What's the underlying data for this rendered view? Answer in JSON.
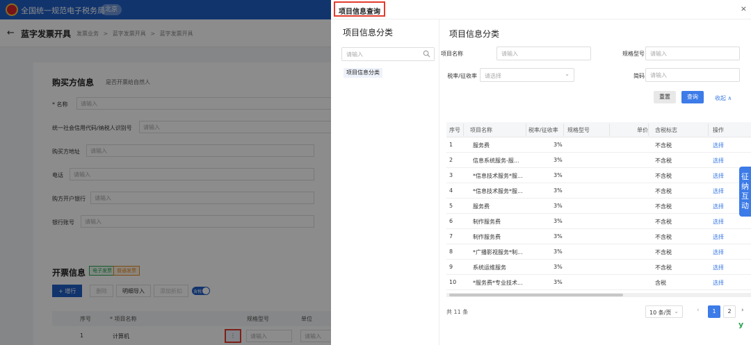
{
  "background": {
    "topbar": {
      "title": "全国统一规范电子税务局",
      "region": "北京"
    },
    "subbar": {
      "back": "←",
      "page_title": "蓝字发票开具",
      "crumbs": [
        "发票业务",
        ">",
        "蓝字发票开具",
        ">",
        "蓝字发票开具"
      ]
    },
    "buyer": {
      "title": "购买方信息",
      "natural_person_hint": "是否开票给自然人",
      "fields": [
        {
          "label": "* 名称",
          "placeholder": "请输入"
        },
        {
          "label": "统一社会信用代码/纳税人识别号",
          "placeholder": "请输入"
        },
        {
          "label": "购买方地址",
          "placeholder": "请输入"
        },
        {
          "label": "电话",
          "placeholder": "请输入"
        },
        {
          "label": "购方开户银行",
          "placeholder": "请输入"
        },
        {
          "label": "银行账号",
          "placeholder": "请输入"
        }
      ]
    },
    "invoice": {
      "title": "开票信息",
      "tags": [
        "电子发票",
        "普通发票"
      ],
      "buttons": {
        "add_row": "+ 增行",
        "delete": "删除",
        "detail_import": "明细导入",
        "add_discount": "添加折扣"
      },
      "tax_toggle": "含税",
      "headers": [
        "序号",
        "* 项目名称",
        "规格型号",
        "单位"
      ],
      "row": {
        "index": "1",
        "name": "计算机",
        "more": "⋮",
        "placeholder": "请输入"
      }
    }
  },
  "drawer": {
    "title": "项目信息查询",
    "close": "×",
    "tree": {
      "title": "项目信息分类",
      "search_placeholder": "请输入",
      "node": "项目信息分类"
    },
    "main": {
      "title": "项目信息分类",
      "filters": {
        "name_label": "项目名称",
        "name_placeholder": "请输入",
        "spec_label": "规格型号",
        "spec_placeholder": "请输入",
        "rate_label": "税率/征收率",
        "rate_placeholder": "请选择",
        "code_label": "简码",
        "code_placeholder": "请输入"
      },
      "buttons": {
        "reset": "重置",
        "search": "查询",
        "collapse": "收起 ∧"
      },
      "table": {
        "headers": [
          "序号",
          "项目名称",
          "税率/征收率",
          "规格型号",
          "单价",
          "含税标志",
          "操作"
        ],
        "rows": [
          {
            "idx": "1",
            "name": "服务费",
            "rate": "3%",
            "tax": "不含税",
            "op": "选择"
          },
          {
            "idx": "2",
            "name": "信息系统服务-服...",
            "rate": "3%",
            "tax": "不含税",
            "op": "选择"
          },
          {
            "idx": "3",
            "name": "*信息技术服务*服...",
            "rate": "3%",
            "tax": "不含税",
            "op": "选择"
          },
          {
            "idx": "4",
            "name": "*信息技术服务*服...",
            "rate": "3%",
            "tax": "不含税",
            "op": "选择"
          },
          {
            "idx": "5",
            "name": "服务费",
            "rate": "3%",
            "tax": "不含税",
            "op": "选择"
          },
          {
            "idx": "6",
            "name": "制作服务费",
            "rate": "3%",
            "tax": "不含税",
            "op": "选择"
          },
          {
            "idx": "7",
            "name": "制作服务费",
            "rate": "3%",
            "tax": "不含税",
            "op": "选择"
          },
          {
            "idx": "8",
            "name": "*广播影视服务*制...",
            "rate": "3%",
            "tax": "不含税",
            "op": "选择"
          },
          {
            "idx": "9",
            "name": "系统运维服务",
            "rate": "3%",
            "tax": "不含税",
            "op": "选择"
          },
          {
            "idx": "10",
            "name": "*服务费*专业技术...",
            "rate": "3%",
            "tax": "含税",
            "op": "选择"
          }
        ]
      },
      "pagination": {
        "total": "共 11 条",
        "page_size": "10 条/页",
        "prev": "‹",
        "pages": [
          "1",
          "2"
        ],
        "next": "›"
      }
    }
  },
  "side_tab": "征纳互动",
  "corner_logo": "y"
}
